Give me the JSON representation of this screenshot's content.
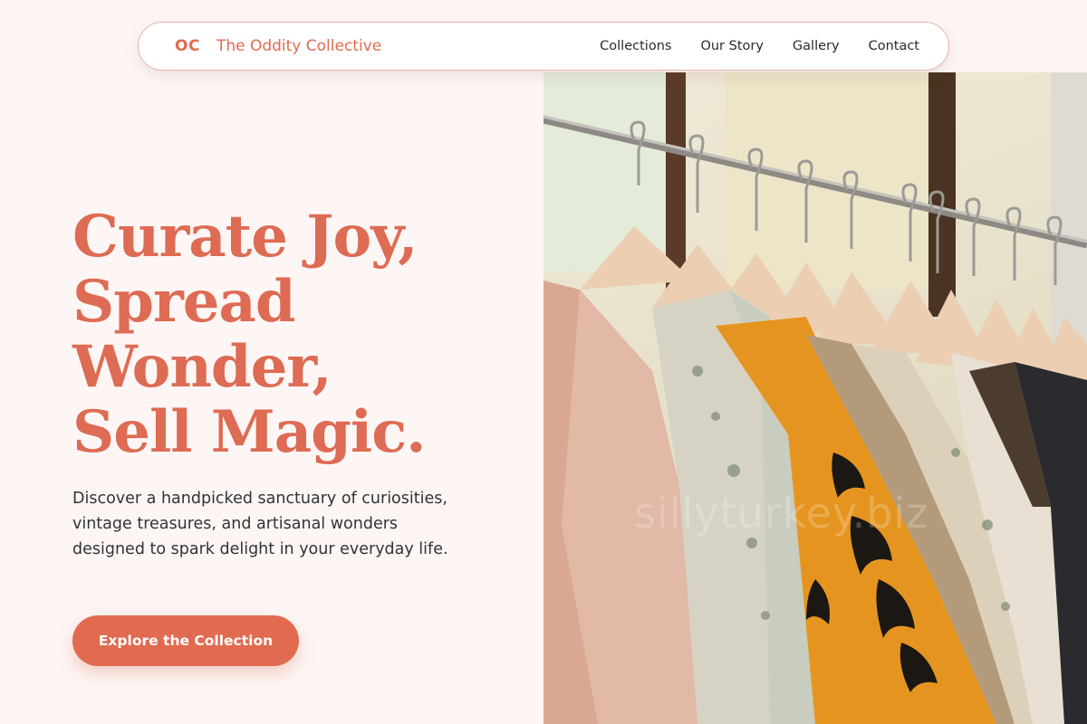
{
  "brand": {
    "mark": "OC",
    "name": "The Oddity Collective"
  },
  "nav": {
    "links": [
      "Collections",
      "Our Story",
      "Gallery",
      "Contact"
    ]
  },
  "hero": {
    "headline_lines": [
      "Curate Joy,",
      "Spread",
      "Wonder,",
      "Sell Magic."
    ],
    "description": "Discover a handpicked sanctuary of curiosities, vintage treasures, and artisanal wonders designed to spark delight in your everyday life.",
    "cta_label": "Explore the Collection",
    "image_watermark": "sillyturkey.biz"
  },
  "colors": {
    "accent": "#e06b50",
    "background": "#fdf6f5",
    "text": "#333333"
  }
}
